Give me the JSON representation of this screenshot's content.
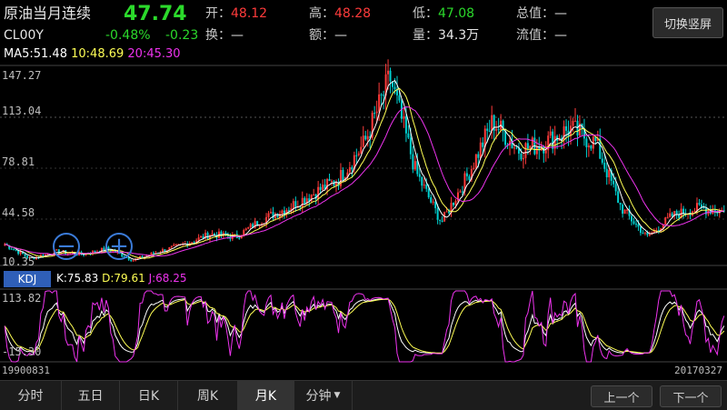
{
  "header": {
    "name": "原油当月连续",
    "code": "CL00Y",
    "price": "47.74",
    "change_pct": "-0.48%",
    "change": "-0.23",
    "open_label": "开：",
    "open": "48.12",
    "turnover_label": "换：",
    "turnover": "—",
    "high_label": "高：",
    "high": "48.28",
    "amount_label": "额：",
    "amount": "—",
    "low_label": "低：",
    "low": "47.08",
    "volume_label": "量：",
    "volume": "34.3万",
    "total_value_label": "总值：",
    "total_value": "—",
    "float_value_label": "流值：",
    "float_value": "—",
    "switch_button": "切换竖屏"
  },
  "ma": {
    "ma5": "MA5:51.48",
    "ma10": "10:48.69",
    "ma20": "20:45.30"
  },
  "price_axis": [
    "147.27",
    "113.04",
    "78.81",
    "44.58",
    "10.35"
  ],
  "kdj": {
    "button": "KDJ",
    "k": "K:75.83",
    "d": "D:79.61",
    "j": "J:68.25"
  },
  "kdj_axis": [
    "113.82",
    "-15.30"
  ],
  "dates": {
    "start": "19900831",
    "end": "20170327"
  },
  "tabs": [
    "分时",
    "五日",
    "日K",
    "周K",
    "月K",
    "分钟"
  ],
  "active_tab": "月K",
  "nav": {
    "prev": "上一个",
    "next": "下一个"
  },
  "colors": {
    "up": "#ff3b3b",
    "down": "#00d0d0",
    "ma5": "#ffffff",
    "ma10": "#ffff55",
    "ma20": "#ee33ee",
    "accent": "#3b7bd8"
  },
  "chart_data": {
    "type": "candlestick",
    "series": [
      {
        "name": "MA5",
        "values": []
      },
      {
        "name": "MA10",
        "values": []
      },
      {
        "name": "MA20",
        "values": []
      }
    ],
    "key_points": [
      {
        "x": "19900831",
        "y": 25
      },
      {
        "y": 15
      },
      {
        "y": 20
      },
      {
        "y": 18
      },
      {
        "y": 22
      },
      {
        "y": 14
      },
      {
        "y": 20
      },
      {
        "y": 25
      },
      {
        "y": 32
      },
      {
        "y": 30
      },
      {
        "y": 42
      },
      {
        "y": 50
      },
      {
        "y": 60
      },
      {
        "y": 70
      },
      {
        "y": 95
      },
      {
        "y": 140
      },
      {
        "y": 75
      },
      {
        "y": 40
      },
      {
        "y": 72
      },
      {
        "y": 110
      },
      {
        "y": 90
      },
      {
        "y": 95
      },
      {
        "y": 105
      },
      {
        "y": 95
      },
      {
        "y": 50
      },
      {
        "y": 30
      },
      {
        "y": 45
      },
      {
        "y": 50
      },
      {
        "x": "20170327",
        "y": 47.74
      }
    ],
    "ylim": [
      10.35,
      147.27
    ],
    "kdj_ylim": [
      -15.3,
      113.82
    ]
  }
}
